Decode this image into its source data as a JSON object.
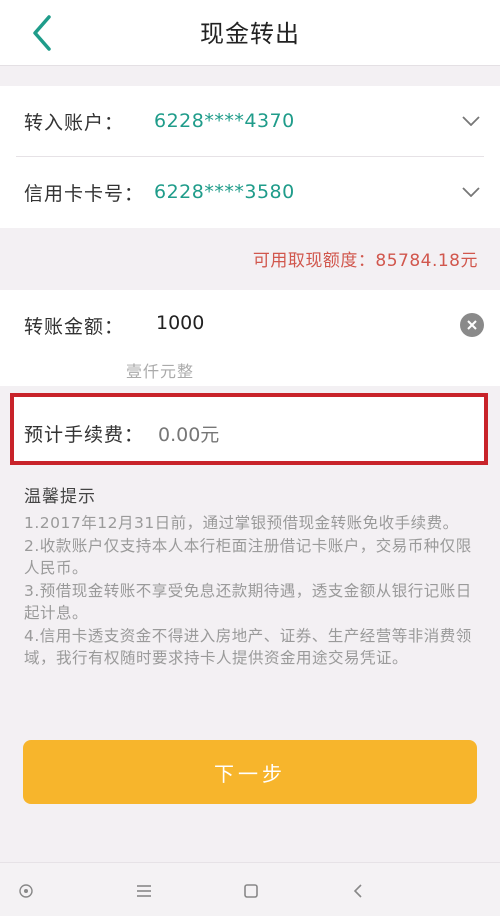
{
  "header": {
    "title": "现金转出",
    "back_icon": "chevron-left-icon"
  },
  "accounts": {
    "transfer_in": {
      "label": "转入账户：",
      "value": "6228****4370"
    },
    "credit_card": {
      "label": "信用卡卡号：",
      "value": "6228****3580"
    }
  },
  "quota": {
    "text": "可用取现额度：85784.18元"
  },
  "amount": {
    "label": "转账金额：",
    "value": "1000",
    "in_words": "壹仟元整"
  },
  "fee": {
    "label": "预计手续费：",
    "value": "0.00元"
  },
  "tips": {
    "title": "温馨提示",
    "items": [
      "1.2017年12月31日前，通过掌银预借现金转账免收手续费。",
      "2.收款账户仅支持本人本行柜面注册借记卡账户，交易币种仅限人民币。",
      "3.预借现金转账不享受免息还款期待遇，透支金额从银行记账日起计息。",
      "4.信用卡透支资金不得进入房地产、证券、生产经营等非消费领域，我行有权随时要求持卡人提供资金用途交易凭证。"
    ]
  },
  "next_button": {
    "label": "下一步"
  },
  "colors": {
    "accent_green": "#1f9c8a",
    "button_orange": "#f7b52c",
    "highlight_red": "#c8232a",
    "quota_red": "#d1574d"
  }
}
